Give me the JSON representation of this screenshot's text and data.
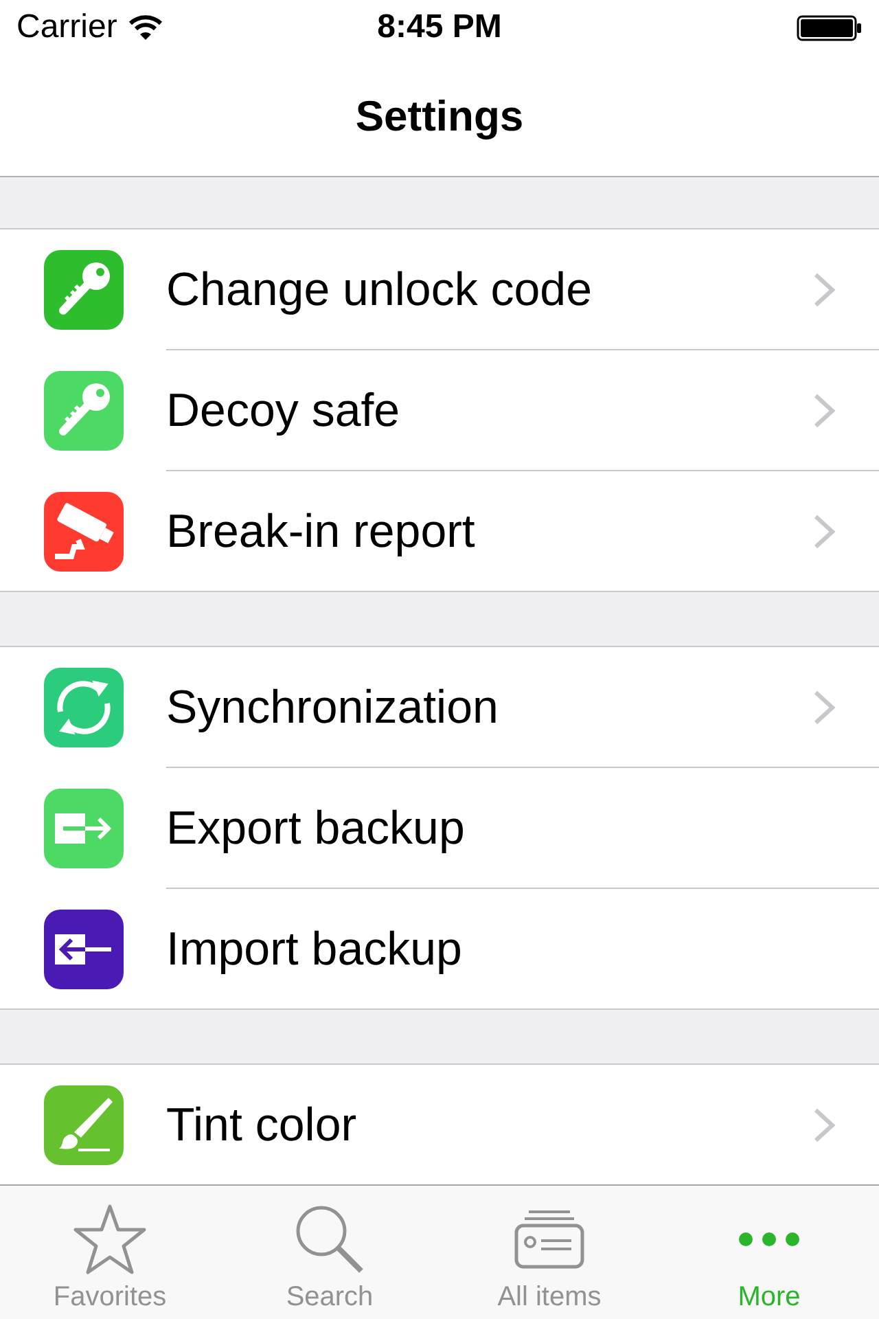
{
  "status_bar": {
    "carrier": "Carrier",
    "time": "8:45 PM"
  },
  "nav_bar": {
    "title": "Settings"
  },
  "sections": [
    {
      "rows": [
        {
          "label": "Change unlock code",
          "kind": "key",
          "color": "#2dbd2d",
          "disclosure": true
        },
        {
          "label": "Decoy safe",
          "kind": "key",
          "color": "#4cd964",
          "disclosure": true
        },
        {
          "label": "Break-in report",
          "kind": "camera",
          "color": "#ff3b30",
          "disclosure": true
        }
      ]
    },
    {
      "rows": [
        {
          "label": "Synchronization",
          "kind": "sync",
          "color": "#2bcc7b",
          "disclosure": true
        },
        {
          "label": "Export backup",
          "kind": "export",
          "color": "#4cd964",
          "disclosure": false
        },
        {
          "label": "Import backup",
          "kind": "import",
          "color": "#4b19b4",
          "disclosure": false
        }
      ]
    },
    {
      "rows": [
        {
          "label": "Tint color",
          "kind": "brush",
          "color": "#66c12e",
          "disclosure": true
        }
      ]
    }
  ],
  "tab_bar": {
    "items": [
      {
        "label": "Favorites",
        "kind": "star",
        "selected": false
      },
      {
        "label": "Search",
        "kind": "search",
        "selected": false
      },
      {
        "label": "All items",
        "kind": "cards",
        "selected": false
      },
      {
        "label": "More",
        "kind": "more",
        "selected": true
      }
    ]
  }
}
